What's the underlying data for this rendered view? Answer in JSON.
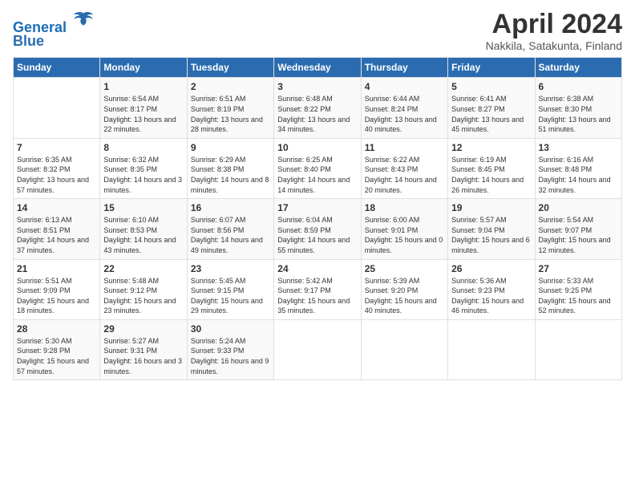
{
  "header": {
    "logo_line1": "General",
    "logo_line2": "Blue",
    "month": "April 2024",
    "location": "Nakkila, Satakunta, Finland"
  },
  "days_of_week": [
    "Sunday",
    "Monday",
    "Tuesday",
    "Wednesday",
    "Thursday",
    "Friday",
    "Saturday"
  ],
  "weeks": [
    [
      {
        "day": "",
        "sunrise": "",
        "sunset": "",
        "daylight": ""
      },
      {
        "day": "1",
        "sunrise": "Sunrise: 6:54 AM",
        "sunset": "Sunset: 8:17 PM",
        "daylight": "Daylight: 13 hours and 22 minutes."
      },
      {
        "day": "2",
        "sunrise": "Sunrise: 6:51 AM",
        "sunset": "Sunset: 8:19 PM",
        "daylight": "Daylight: 13 hours and 28 minutes."
      },
      {
        "day": "3",
        "sunrise": "Sunrise: 6:48 AM",
        "sunset": "Sunset: 8:22 PM",
        "daylight": "Daylight: 13 hours and 34 minutes."
      },
      {
        "day": "4",
        "sunrise": "Sunrise: 6:44 AM",
        "sunset": "Sunset: 8:24 PM",
        "daylight": "Daylight: 13 hours and 40 minutes."
      },
      {
        "day": "5",
        "sunrise": "Sunrise: 6:41 AM",
        "sunset": "Sunset: 8:27 PM",
        "daylight": "Daylight: 13 hours and 45 minutes."
      },
      {
        "day": "6",
        "sunrise": "Sunrise: 6:38 AM",
        "sunset": "Sunset: 8:30 PM",
        "daylight": "Daylight: 13 hours and 51 minutes."
      }
    ],
    [
      {
        "day": "7",
        "sunrise": "Sunrise: 6:35 AM",
        "sunset": "Sunset: 8:32 PM",
        "daylight": "Daylight: 13 hours and 57 minutes."
      },
      {
        "day": "8",
        "sunrise": "Sunrise: 6:32 AM",
        "sunset": "Sunset: 8:35 PM",
        "daylight": "Daylight: 14 hours and 3 minutes."
      },
      {
        "day": "9",
        "sunrise": "Sunrise: 6:29 AM",
        "sunset": "Sunset: 8:38 PM",
        "daylight": "Daylight: 14 hours and 8 minutes."
      },
      {
        "day": "10",
        "sunrise": "Sunrise: 6:25 AM",
        "sunset": "Sunset: 8:40 PM",
        "daylight": "Daylight: 14 hours and 14 minutes."
      },
      {
        "day": "11",
        "sunrise": "Sunrise: 6:22 AM",
        "sunset": "Sunset: 8:43 PM",
        "daylight": "Daylight: 14 hours and 20 minutes."
      },
      {
        "day": "12",
        "sunrise": "Sunrise: 6:19 AM",
        "sunset": "Sunset: 8:45 PM",
        "daylight": "Daylight: 14 hours and 26 minutes."
      },
      {
        "day": "13",
        "sunrise": "Sunrise: 6:16 AM",
        "sunset": "Sunset: 8:48 PM",
        "daylight": "Daylight: 14 hours and 32 minutes."
      }
    ],
    [
      {
        "day": "14",
        "sunrise": "Sunrise: 6:13 AM",
        "sunset": "Sunset: 8:51 PM",
        "daylight": "Daylight: 14 hours and 37 minutes."
      },
      {
        "day": "15",
        "sunrise": "Sunrise: 6:10 AM",
        "sunset": "Sunset: 8:53 PM",
        "daylight": "Daylight: 14 hours and 43 minutes."
      },
      {
        "day": "16",
        "sunrise": "Sunrise: 6:07 AM",
        "sunset": "Sunset: 8:56 PM",
        "daylight": "Daylight: 14 hours and 49 minutes."
      },
      {
        "day": "17",
        "sunrise": "Sunrise: 6:04 AM",
        "sunset": "Sunset: 8:59 PM",
        "daylight": "Daylight: 14 hours and 55 minutes."
      },
      {
        "day": "18",
        "sunrise": "Sunrise: 6:00 AM",
        "sunset": "Sunset: 9:01 PM",
        "daylight": "Daylight: 15 hours and 0 minutes."
      },
      {
        "day": "19",
        "sunrise": "Sunrise: 5:57 AM",
        "sunset": "Sunset: 9:04 PM",
        "daylight": "Daylight: 15 hours and 6 minutes."
      },
      {
        "day": "20",
        "sunrise": "Sunrise: 5:54 AM",
        "sunset": "Sunset: 9:07 PM",
        "daylight": "Daylight: 15 hours and 12 minutes."
      }
    ],
    [
      {
        "day": "21",
        "sunrise": "Sunrise: 5:51 AM",
        "sunset": "Sunset: 9:09 PM",
        "daylight": "Daylight: 15 hours and 18 minutes."
      },
      {
        "day": "22",
        "sunrise": "Sunrise: 5:48 AM",
        "sunset": "Sunset: 9:12 PM",
        "daylight": "Daylight: 15 hours and 23 minutes."
      },
      {
        "day": "23",
        "sunrise": "Sunrise: 5:45 AM",
        "sunset": "Sunset: 9:15 PM",
        "daylight": "Daylight: 15 hours and 29 minutes."
      },
      {
        "day": "24",
        "sunrise": "Sunrise: 5:42 AM",
        "sunset": "Sunset: 9:17 PM",
        "daylight": "Daylight: 15 hours and 35 minutes."
      },
      {
        "day": "25",
        "sunrise": "Sunrise: 5:39 AM",
        "sunset": "Sunset: 9:20 PM",
        "daylight": "Daylight: 15 hours and 40 minutes."
      },
      {
        "day": "26",
        "sunrise": "Sunrise: 5:36 AM",
        "sunset": "Sunset: 9:23 PM",
        "daylight": "Daylight: 15 hours and 46 minutes."
      },
      {
        "day": "27",
        "sunrise": "Sunrise: 5:33 AM",
        "sunset": "Sunset: 9:25 PM",
        "daylight": "Daylight: 15 hours and 52 minutes."
      }
    ],
    [
      {
        "day": "28",
        "sunrise": "Sunrise: 5:30 AM",
        "sunset": "Sunset: 9:28 PM",
        "daylight": "Daylight: 15 hours and 57 minutes."
      },
      {
        "day": "29",
        "sunrise": "Sunrise: 5:27 AM",
        "sunset": "Sunset: 9:31 PM",
        "daylight": "Daylight: 16 hours and 3 minutes."
      },
      {
        "day": "30",
        "sunrise": "Sunrise: 5:24 AM",
        "sunset": "Sunset: 9:33 PM",
        "daylight": "Daylight: 16 hours and 9 minutes."
      },
      {
        "day": "",
        "sunrise": "",
        "sunset": "",
        "daylight": ""
      },
      {
        "day": "",
        "sunrise": "",
        "sunset": "",
        "daylight": ""
      },
      {
        "day": "",
        "sunrise": "",
        "sunset": "",
        "daylight": ""
      },
      {
        "day": "",
        "sunrise": "",
        "sunset": "",
        "daylight": ""
      }
    ]
  ]
}
